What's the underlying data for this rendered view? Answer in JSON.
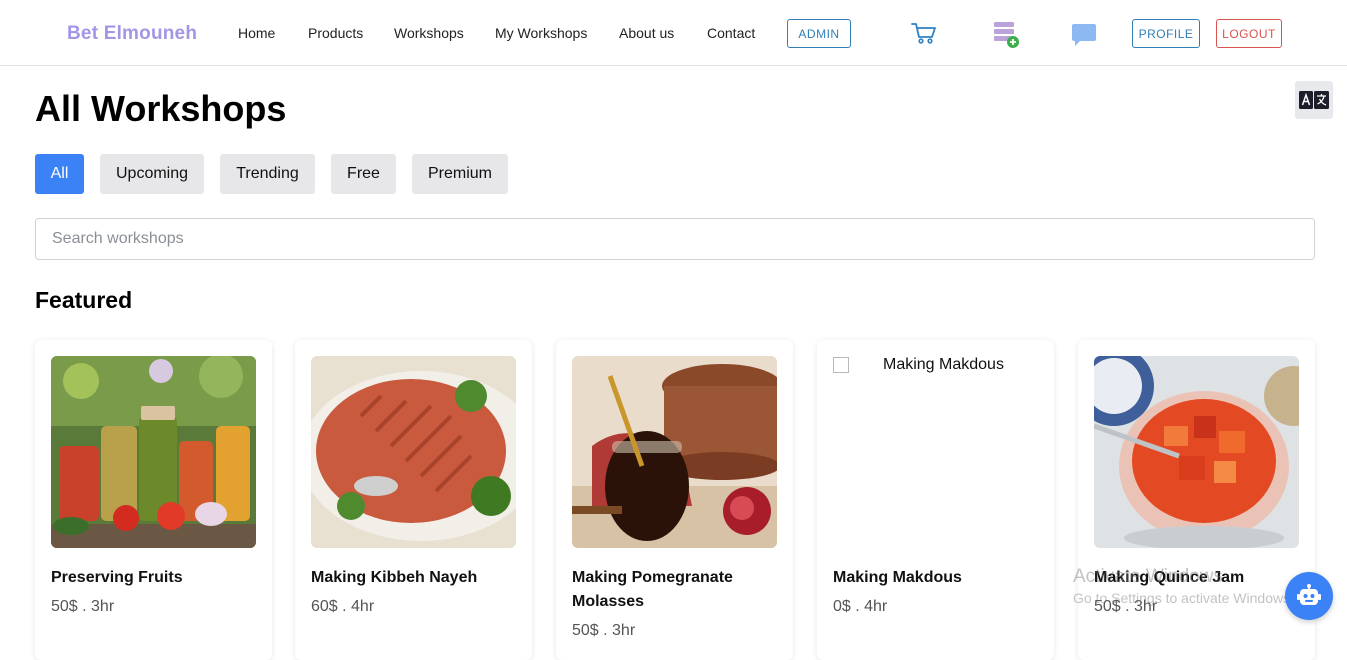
{
  "nav": {
    "brand": "Bet Elmouneh",
    "links": [
      "Home",
      "Products",
      "Workshops",
      "My Workshops",
      "About us",
      "Contact"
    ],
    "admin_label": "ADMIN",
    "profile_label": "PROFILE",
    "logout_label": "LOGOUT",
    "icons": [
      "cart-icon",
      "add-listing-icon",
      "chat-icon"
    ]
  },
  "translate_icon": "translate-icon",
  "page": {
    "title": "All Workshops",
    "filters": [
      "All",
      "Upcoming",
      "Trending",
      "Free",
      "Premium"
    ],
    "active_filter": "All",
    "search_placeholder": "Search workshops",
    "featured_title": "Featured"
  },
  "workshops": [
    {
      "title": "Preserving Fruits",
      "meta": "50$ . 3hr",
      "image": "jars-of-preserves"
    },
    {
      "title": "Making Kibbeh Nayeh",
      "meta": "60$ . 4hr",
      "image": "kibbeh-plate"
    },
    {
      "title": "Making Pomegranate Molasses",
      "meta": "50$ . 3hr",
      "image": "molasses-jar"
    },
    {
      "title": "Making Makdous",
      "meta": "0$ . 4hr",
      "image_alt": "Making Makdous"
    },
    {
      "title": "Making Quince Jam",
      "meta": "50$ . 3hr",
      "image": "quince-jam-jar"
    }
  ],
  "watermark": {
    "line1": "Activate Windows",
    "line2": "Go to Settings to activate Windows."
  },
  "colors": {
    "brand": "#a197e6",
    "primary": "#3b82f6",
    "outline_blue": "#2f7fb6",
    "logout_red": "#d9534f"
  }
}
